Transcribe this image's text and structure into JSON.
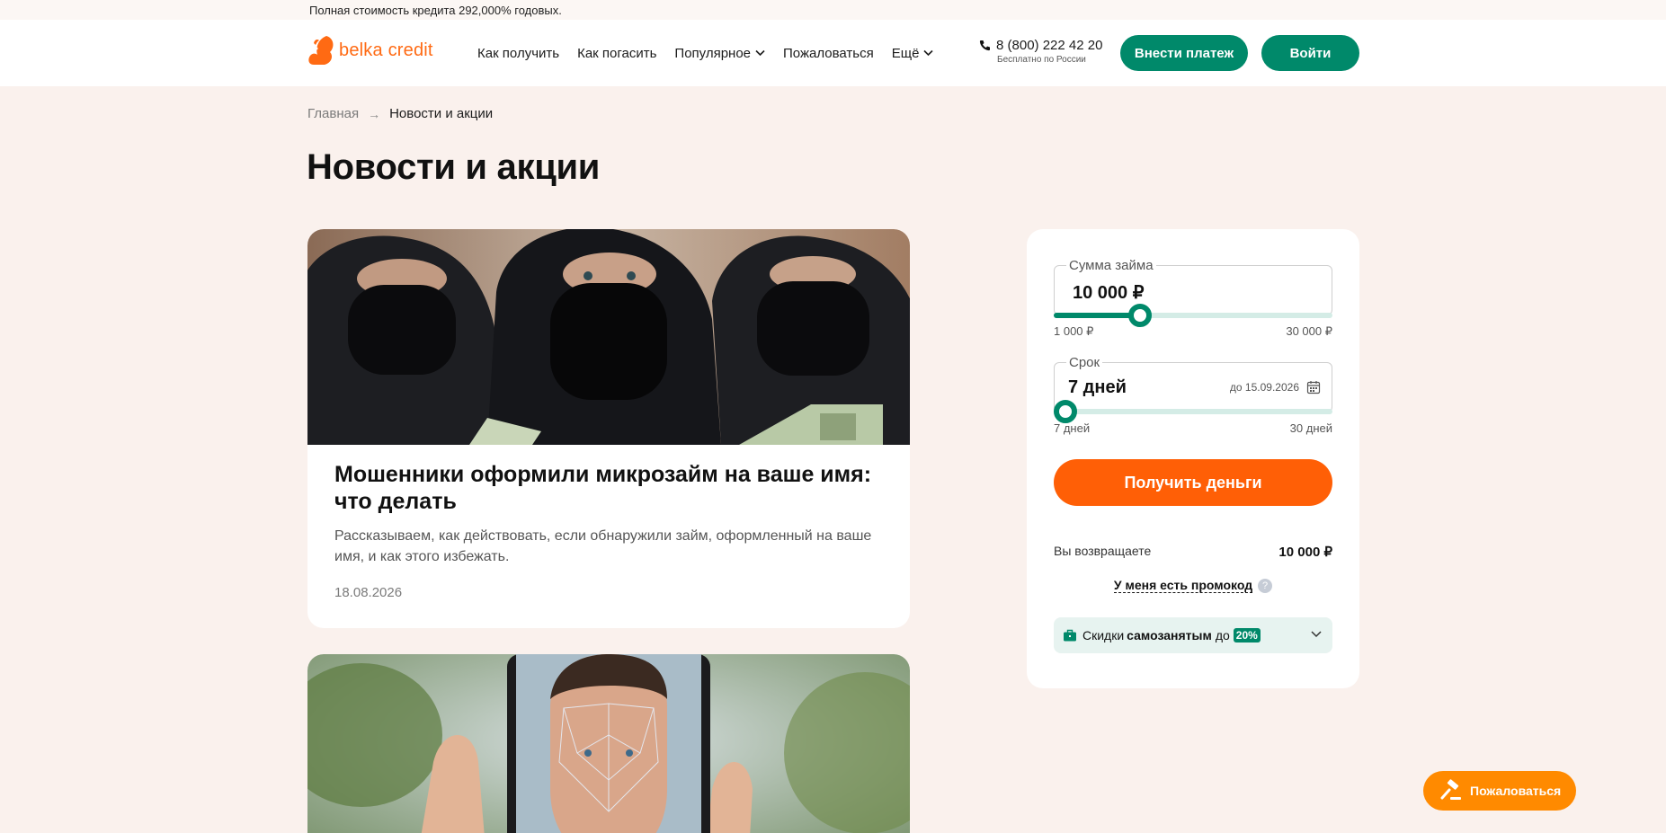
{
  "topline": {
    "text": "Полная стоимость кредита 292,000% годовых."
  },
  "header": {
    "logo_text": "belka credit",
    "nav": [
      {
        "label": "Как получить",
        "has_dropdown": false
      },
      {
        "label": "Как погасить",
        "has_dropdown": false
      },
      {
        "label": "Популярное",
        "has_dropdown": true
      },
      {
        "label": "Пожаловаться",
        "has_dropdown": false
      },
      {
        "label": "Ещё",
        "has_dropdown": true
      }
    ],
    "phone": "8 (800) 222 42 20",
    "phone_sub": "Бесплатно по России",
    "pay_button": "Внести платеж",
    "login_button": "Войти"
  },
  "breadcrumb": {
    "home": "Главная",
    "arrow": "→",
    "current": "Новости и акции"
  },
  "page_title": "Новости и акции",
  "articles": [
    {
      "title": "Мошенники оформили микрозайм на ваше имя: что делать",
      "description": "Рассказываем, как действовать, если обнаружили займ, оформленный на ваше имя, и как этого избежать.",
      "date": "18.08.2026"
    }
  ],
  "calculator": {
    "sum_label": "Сумма займа",
    "sum_value": "10 000 ₽",
    "sum_fraction": 0.31,
    "sum_min": "1 000 ₽",
    "sum_max": "30 000 ₽",
    "term_label": "Срок",
    "term_value": "7 дней",
    "term_until": "до 15.09.2026",
    "term_fraction": 0.0,
    "term_min": "7 дней",
    "term_max": "30 дней",
    "submit": "Получить деньги",
    "return_label": "Вы возвращаете",
    "return_value": "10 000 ₽",
    "promo": "У меня есть промокод",
    "promo_help": "?",
    "discount_pre": "Скидки",
    "discount_bold": "самозанятым",
    "discount_post": "до",
    "discount_badge": "20%"
  },
  "complain_button": "Пожаловаться",
  "colors": {
    "brand_orange": "#ff5f06",
    "brand_green": "#00896a",
    "page_bg": "#faf1ed"
  }
}
